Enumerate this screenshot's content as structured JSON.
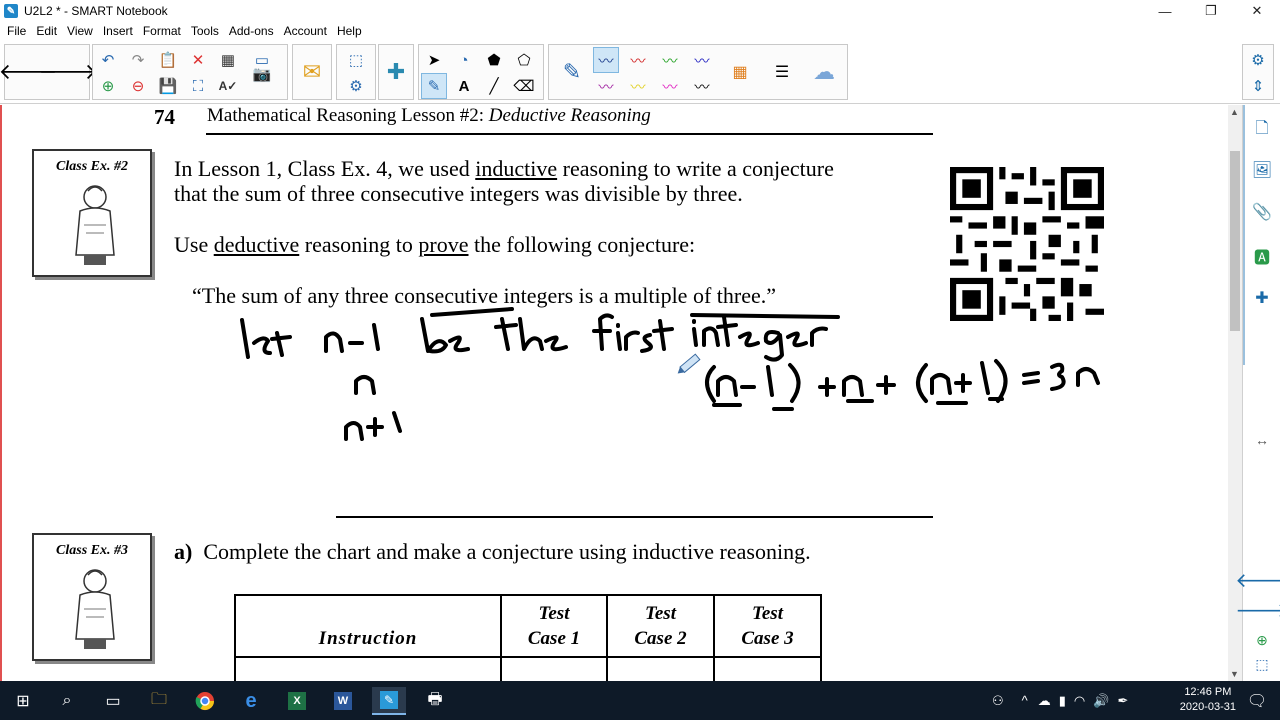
{
  "window": {
    "title": "U2L2 * - SMART Notebook",
    "app_icon": "smart-notebook-icon",
    "controls": [
      "minimize",
      "restore",
      "close"
    ]
  },
  "menu": [
    "File",
    "Edit",
    "View",
    "Insert",
    "Format",
    "Tools",
    "Add-ons",
    "Account",
    "Help"
  ],
  "page": {
    "page_number": "74",
    "lesson_title": "Mathematical Reasoning Lesson #2: ",
    "lesson_subtitle": "Deductive Reasoning",
    "class_ex_2_label": "Class Ex. #2",
    "class_ex_3_label": "Class Ex. #3",
    "p1_line1_pre": "In Lesson 1, Class Ex. 4, we used ",
    "p1_line1_u": "inductive",
    "p1_line1_post": " reasoning to write a conjecture",
    "p1_line2": "that the sum of three consecutive integers was divisible by three.",
    "p2_pre": "Use ",
    "p2_u1": "deductive",
    "p2_mid": " reasoning to ",
    "p2_u2": "prove",
    "p2_post": " the following conjecture:",
    "quote": "“The sum of any three consecutive integers is a multiple of three.”",
    "part_a_label": "a)",
    "part_a_text": "Complete the chart and make a conjecture using inductive reasoning.",
    "table": {
      "headers": [
        "Instruction",
        "Test\nCase  1",
        "Test\nCase  2",
        "Test\nCase  3"
      ],
      "h1_line1": "Test",
      "h1_line2": "Case  1",
      "h2_line1": "Test",
      "h2_line2": "Case  2",
      "h3_line1": "Test",
      "h3_line2": "Case  3"
    },
    "ink_handwriting": [
      "let n-1 be the first integer",
      "n",
      "n+1",
      "(n-1) + n + (n+1) = 3n"
    ]
  },
  "taskbar": {
    "time": "12:46 PM",
    "date": "2020-03-31"
  },
  "colors": {
    "taskbar_bg": "#0e1a28",
    "accent": "#1a6aa8",
    "selected_tool": "#cfe6f7"
  }
}
